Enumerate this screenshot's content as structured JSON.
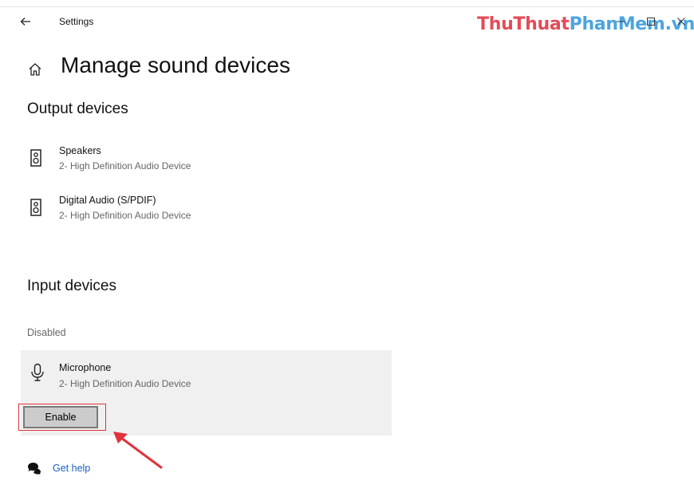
{
  "window": {
    "title": "Settings",
    "watermark_part1": "ThuThuat",
    "watermark_part2": "PhanMem",
    "watermark_part3": ".vn",
    "accent": "#1a62c0"
  },
  "page": {
    "title": "Manage sound devices"
  },
  "output": {
    "heading": "Output devices",
    "devices": [
      {
        "name": "Speakers",
        "sub": "2- High Definition Audio Device",
        "icon": "speaker-icon"
      },
      {
        "name": "Digital Audio (S/PDIF)",
        "sub": "2- High Definition Audio Device",
        "icon": "speaker-icon"
      }
    ]
  },
  "input": {
    "heading": "Input devices",
    "disabled_label": "Disabled",
    "device": {
      "name": "Microphone",
      "sub": "2- High Definition Audio Device",
      "icon": "microphone-icon"
    },
    "enable_label": "Enable"
  },
  "help": {
    "link": "Get help",
    "icon": "help-chat-icon"
  },
  "annotation": {
    "highlight_color": "#e0333c"
  }
}
